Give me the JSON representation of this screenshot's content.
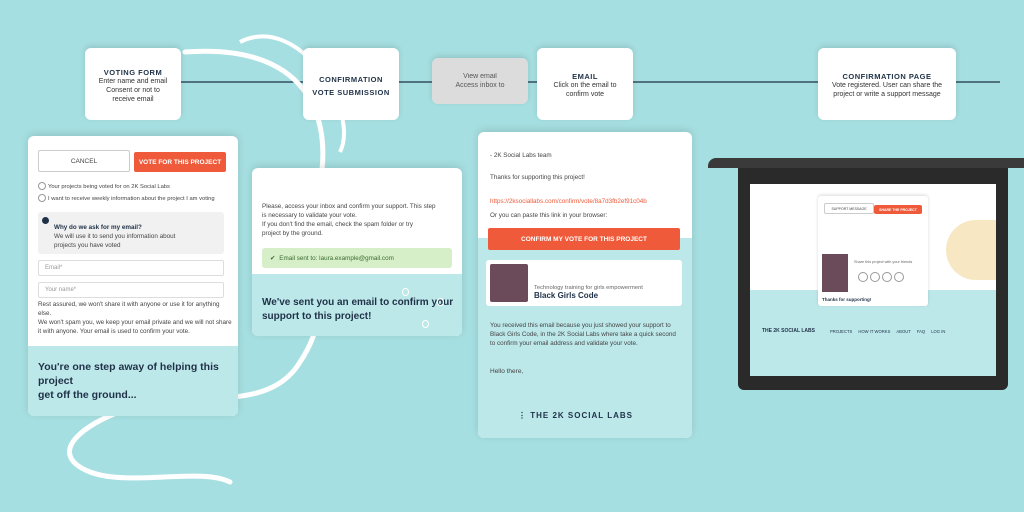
{
  "flow": {
    "voting_form": {
      "title": "VOTING FORM",
      "lines": [
        "Enter name and email",
        "Consent or not to",
        "receive email"
      ]
    },
    "confirmation_submission": {
      "title": "CONFIRMATION",
      "title2": "VOTE SUBMISSION"
    },
    "view_email": {
      "lines": [
        "View email",
        "Access inbox to"
      ]
    },
    "email": {
      "title": "EMAIL",
      "lines": [
        "Click on the email to",
        "confirm vote"
      ]
    },
    "confirmation_page": {
      "title": "CONFIRMATION PAGE",
      "lines": [
        "Vote registered. User can share the",
        "project or write a support message"
      ]
    }
  },
  "vote_form": {
    "cancel_label": "CANCEL",
    "vote_label": "VOTE FOR THIS PROJECT",
    "checkbox1": "Your projects being voted for on 2K Social Labs",
    "checkbox2": "I want to receive weekly information about the project I am voting",
    "why_label": "Why do we ask for my email?",
    "why_text": [
      "We will use it to send you information about",
      "projects you have voted"
    ],
    "email_placeholder": "Email*",
    "name_placeholder": "Your name*",
    "body": [
      "Rest assured, we won't share it with anyone or use it for anything else.",
      "We won't spam you, we keep your email private and we will not share",
      "it with anyone. Your email is used to confirm your vote."
    ],
    "headline1": "You're one step away of helping this project",
    "headline2": "get off the ground..."
  },
  "confirm_panel": {
    "sent_to": "Email sent to: laura.example@gmail.com",
    "body": [
      "Please, access your inbox and confirm your support. This step",
      "is necessary to validate your vote.",
      "If you don't find the email, check the spam folder or try",
      "project by the ground."
    ],
    "headline1": "We've sent you an email to confirm your",
    "headline2": "support to this project!"
  },
  "email_panel": {
    "brand": "THE 2K SOCIAL LABS",
    "greeting": "Hello there,",
    "body": [
      "You received this email because you just showed your support to",
      "Black Girls Code, in the 2K Social Labs where take a quick second",
      "to confirm your email address and validate your vote."
    ],
    "project_name": "Black Girls Code",
    "project_desc": "Technology training for girls empowerment",
    "confirm_label": "CONFIRM MY VOTE FOR THIS PROJECT",
    "paste_hint": "Or you can paste this link in your browser:",
    "link": "https://2ksociallabs.com/confirm/vote/8a7d3fb2ef91c04b",
    "thanks": "Thanks for supporting this project!",
    "signoff": "- 2K Social Labs team"
  },
  "laptop": {
    "brand": "THE 2K SOCIAL LABS",
    "nav": [
      "PROJECTS",
      "HOW IT WORKS",
      "ABOUT",
      "FAQ",
      "LOG IN"
    ],
    "tab_active": "SHARE THE PROJECT",
    "tab_other": "SUPPORT MESSAGE",
    "thanks_text": "Thanks for supporting!",
    "share_hint": "Share this project with your friends"
  },
  "colors": {
    "background": "#a6dfe1",
    "accent": "#ef5a3a",
    "navy": "#1f3147",
    "teal_light": "#bde8ea",
    "success": "#d7efc9"
  }
}
